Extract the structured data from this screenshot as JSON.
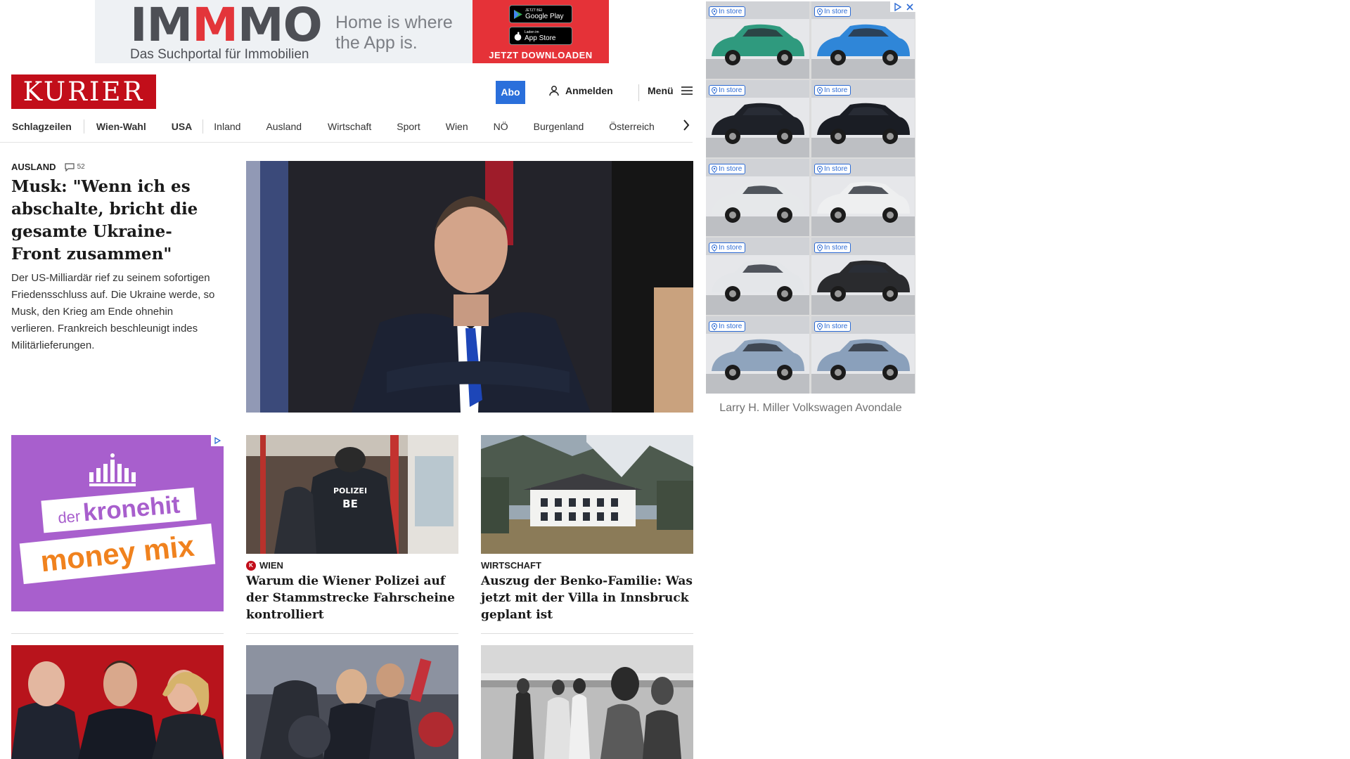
{
  "top_ad": {
    "brand": {
      "part1": "IM",
      "part2": "M",
      "part3": "MO"
    },
    "subtitle": "Das Suchportal für Immobilien",
    "tagline": "Home is where the App is.",
    "google_play_small": "JETZT BEI",
    "google_play": "Google Play",
    "app_store_small": "Laden im",
    "app_store": "App Store",
    "cta": "JETZT DOWNLOADEN"
  },
  "header": {
    "logo": "KURIER",
    "abo": "Abo",
    "login": "Anmelden",
    "menu": "Menü"
  },
  "nav": [
    {
      "label": "Schlagzeilen",
      "bold": true
    },
    {
      "label": "Wien-Wahl",
      "bold": true
    },
    {
      "label": "USA",
      "bold": true
    },
    {
      "label": "Inland",
      "bold": false
    },
    {
      "label": "Ausland",
      "bold": false
    },
    {
      "label": "Wirtschaft",
      "bold": false
    },
    {
      "label": "Sport",
      "bold": false
    },
    {
      "label": "Wien",
      "bold": false
    },
    {
      "label": "NÖ",
      "bold": false
    },
    {
      "label": "Burgenland",
      "bold": false
    },
    {
      "label": "Österreich",
      "bold": false
    }
  ],
  "lead": {
    "kicker": "AUSLAND",
    "comments": "52",
    "title": "Musk: \"Wenn ich es abschalte, bricht die gesamte Ukraine-Front zusammen\"",
    "teaser": "Der US-Milliardär rief zu seinem sofortigen Friedensschluss auf. Die Ukraine werde, so Musk, den Krieg am Ende ohnehin verlieren. Frankreich beschleunigt indes Militärlieferungen."
  },
  "cards": [
    {
      "kicker": "WIEN",
      "badge": "K",
      "title": "Warum die Wiener Polizei auf der Stammstrecke Fahrscheine kontrolliert",
      "uniform_text": "POLIZEI",
      "uniform_code": "BE"
    },
    {
      "kicker": "WIRTSCHAFT",
      "title": "Auszug der Benko-Familie: Was jetzt mit der Villa in Innsbruck geplant ist"
    }
  ],
  "left_ad": {
    "line1_prefix": "der",
    "line1": "kronehit",
    "line2": "money mix"
  },
  "right_ad": {
    "tile_label": "In store",
    "tiles": [
      {
        "car": "#2f9a7e"
      },
      {
        "car": "#2f86d8"
      },
      {
        "car": "#1e2128"
      },
      {
        "car": "#1a1d24"
      },
      {
        "car": "#e6e8ea"
      },
      {
        "car": "#eeeff0"
      },
      {
        "car": "#e4e6e9"
      },
      {
        "car": "#2a2b2e"
      },
      {
        "car": "#8fa4bd"
      },
      {
        "car": "#8aa0bb"
      }
    ],
    "dealer": "Larry H. Miller Volkswagen Avondale"
  },
  "colors": {
    "brand_red": "#c20e1a",
    "abo_blue": "#2a6fdb",
    "ad_purple": "#a85fcd"
  }
}
